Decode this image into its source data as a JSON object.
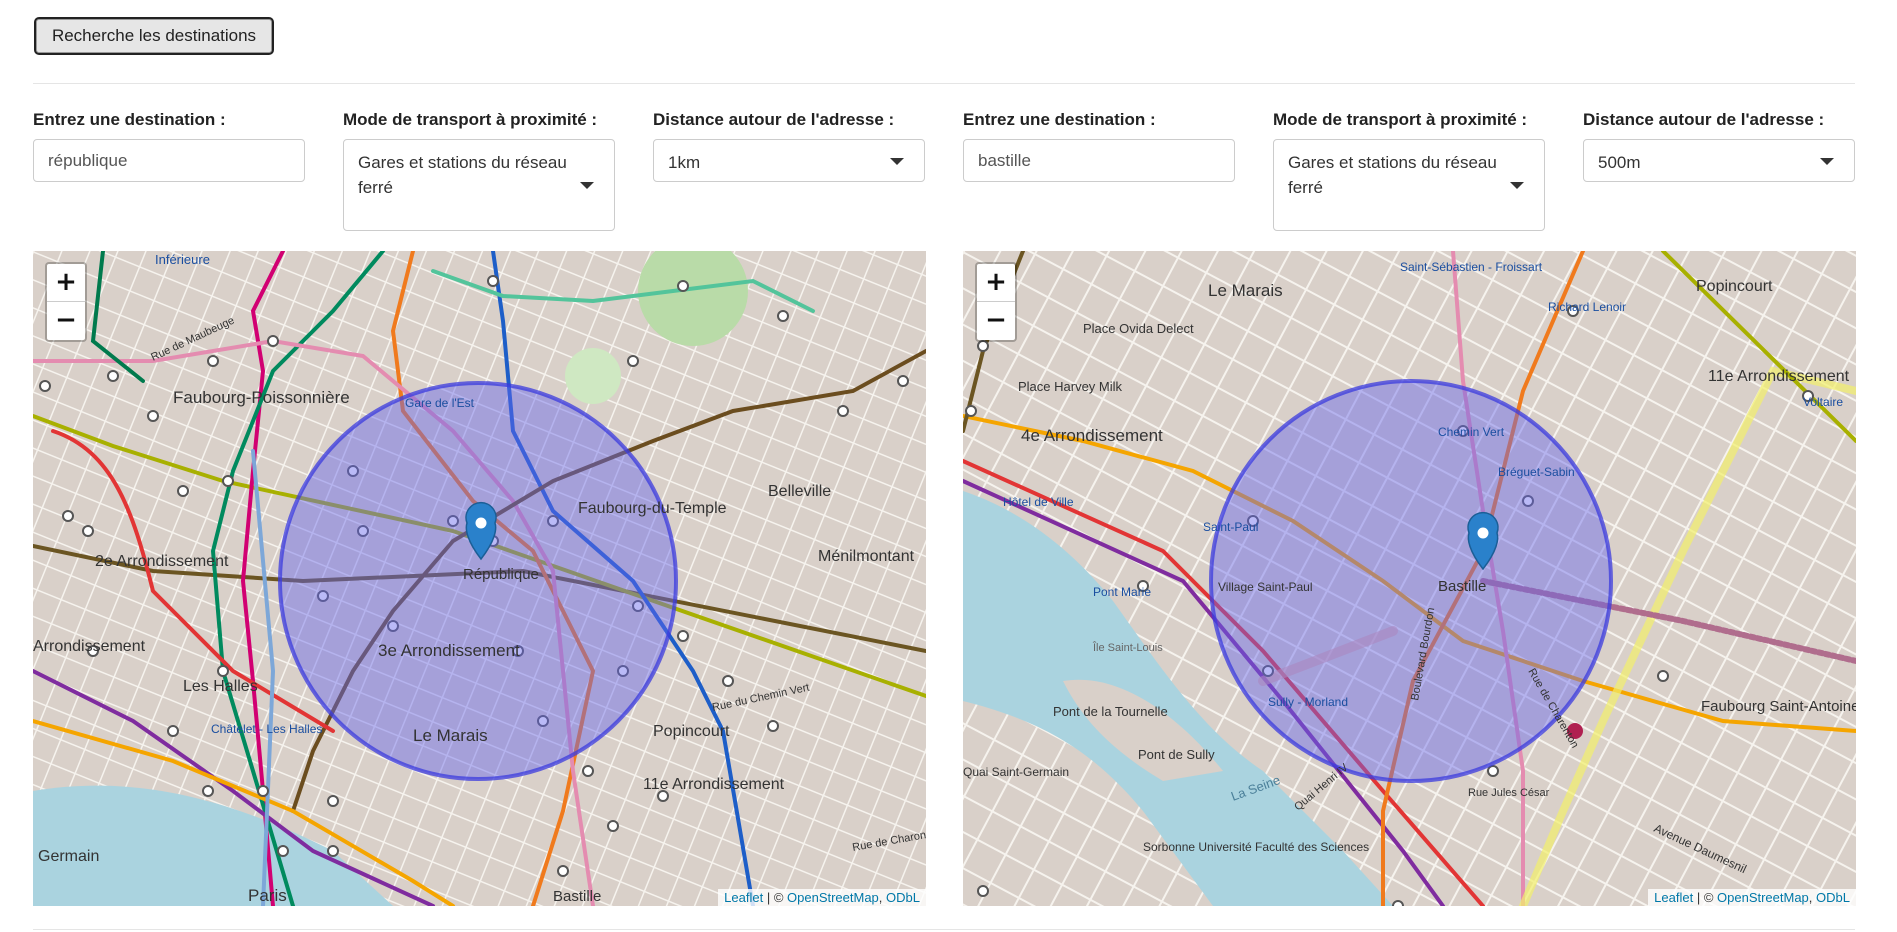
{
  "toolbar": {
    "search_button": "Recherche les destinations"
  },
  "attribution": {
    "leaflet": "Leaflet",
    "sep": " | © ",
    "osm": "OpenStreetMap",
    "comma": ", ",
    "odbl": "ODbL"
  },
  "zoom": {
    "in": "+",
    "out": "−"
  },
  "panels": [
    {
      "destination_label": "Entrez une destination :",
      "destination_value": "république",
      "transport_label": "Mode de transport à proximité :",
      "transport_value": "Gares et stations du réseau ferré",
      "distance_label": "Distance autour de l'adresse :",
      "distance_value": "1km",
      "map_labels": [
        "Inférieure",
        "Faubourg-Poissonnière",
        "Belleville",
        "Faubourg-du-Temple",
        "Ménilmontant",
        "2e Arrondissement",
        "3e Arrondissement",
        "République",
        "Le Marais",
        "Les Halles",
        "Châtelet - Les Halles",
        "Popincourt",
        "11e Arrondissement",
        "Arrondissement",
        "Gare de l'Est",
        "Paris",
        "Bastille",
        "Rue de Maubeuge",
        "Rue du Chemin Vert",
        "Rue de Charonne",
        "Germain"
      ]
    },
    {
      "destination_label": "Entrez une destination :",
      "destination_value": "bastille",
      "transport_label": "Mode de transport à proximité :",
      "transport_value": "Gares et stations du réseau ferré",
      "distance_label": "Distance autour de l'adresse :",
      "distance_value": "500m",
      "map_labels": [
        "Le Marais",
        "Saint-Sébastien - Froissart",
        "Richard Lenoir",
        "Popincourt",
        "Place Ovida Delect",
        "Place Harvey Milk",
        "Hôtel de Ville",
        "4e Arrondissement",
        "Chemin Vert",
        "Bréguet-Sabin",
        "11e Arrondissement",
        "Voltaire",
        "Saint-Paul",
        "Pont Marie",
        "Village Saint-Paul",
        "Bastille",
        "Faubourg Saint-Antoine",
        "Sully - Morland",
        "Pont de la Tournelle",
        "Pont de Sully",
        "La Seine",
        "Île Saint-Louis",
        "Quai Henri IV",
        "Rue Jules César",
        "Avenue Daumesnil",
        "Sorbonne Université Faculté des Sciences",
        "Boulevard Bourdon",
        "Rue de Charenton",
        "Quai Saint-Germain"
      ]
    }
  ],
  "map_markers": [
    {
      "panel": 0,
      "circle_radius_label": "1km"
    },
    {
      "panel": 1,
      "circle_radius_label": "500m"
    }
  ],
  "colors": {
    "circle_fill": "#6666ee",
    "circle_stroke": "#3b3bdd",
    "marker": "#2a81cb",
    "map_bg": "#ddd6cc",
    "water": "#aad3df"
  }
}
